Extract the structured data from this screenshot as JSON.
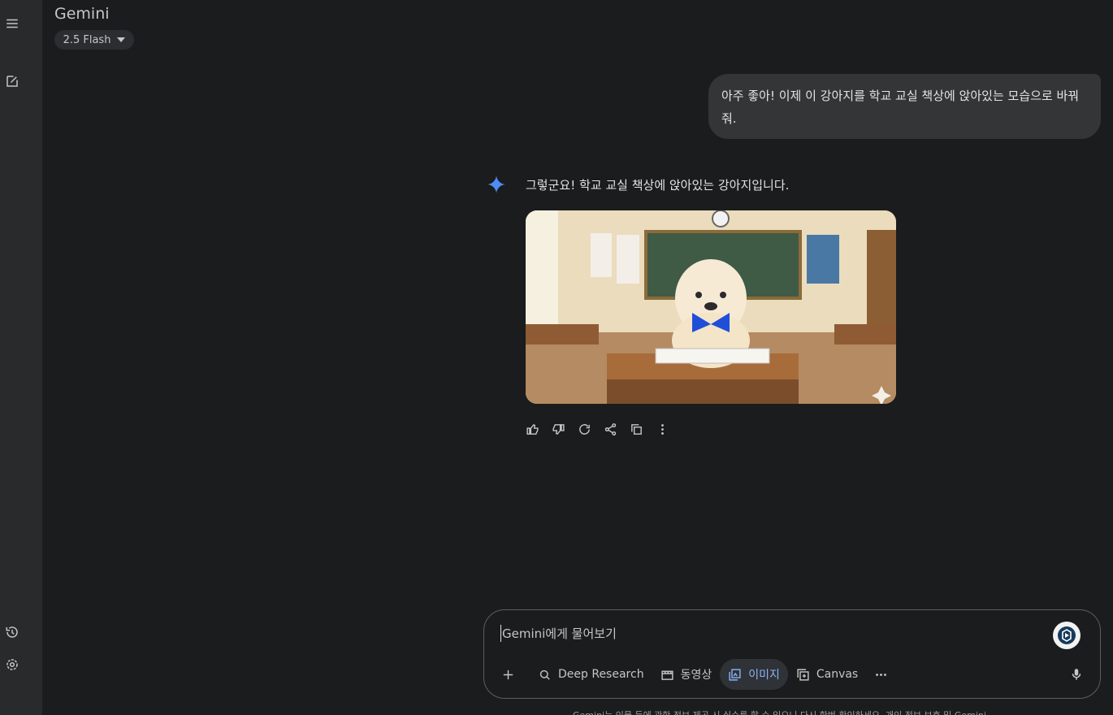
{
  "app": {
    "title": "Gemini",
    "model": "2.5 Flash"
  },
  "rail": {
    "icons": [
      "menu-icon",
      "new-chat-icon",
      "history-icon",
      "settings-icon"
    ]
  },
  "conversation": {
    "user_message": "아주 좋아! 이제 이 강아지를 학교 교실 책상에 앉아있는 모습으로 바꿔줘.",
    "assistant_message": "그렇군요! 학교 교실 책상에 앉아있는 강아지입니다.",
    "image_alt": "classroom puppy with blue bow tie on desk"
  },
  "input": {
    "placeholder": "Gemini에게 물어보기",
    "tools": [
      {
        "icon": "deep-research-icon",
        "label": "Deep Research"
      },
      {
        "icon": "video-icon",
        "label": "동영상"
      },
      {
        "icon": "image-icon",
        "label": "이미지",
        "active": true
      },
      {
        "icon": "canvas-icon",
        "label": "Canvas"
      }
    ]
  },
  "disclaimer": "Gemini는 인물 등에 관한 정보 제공 시 실수를 할 수 있으니 다시 한번 확인하세요. 개인 정보 보호 및 Gemini"
}
